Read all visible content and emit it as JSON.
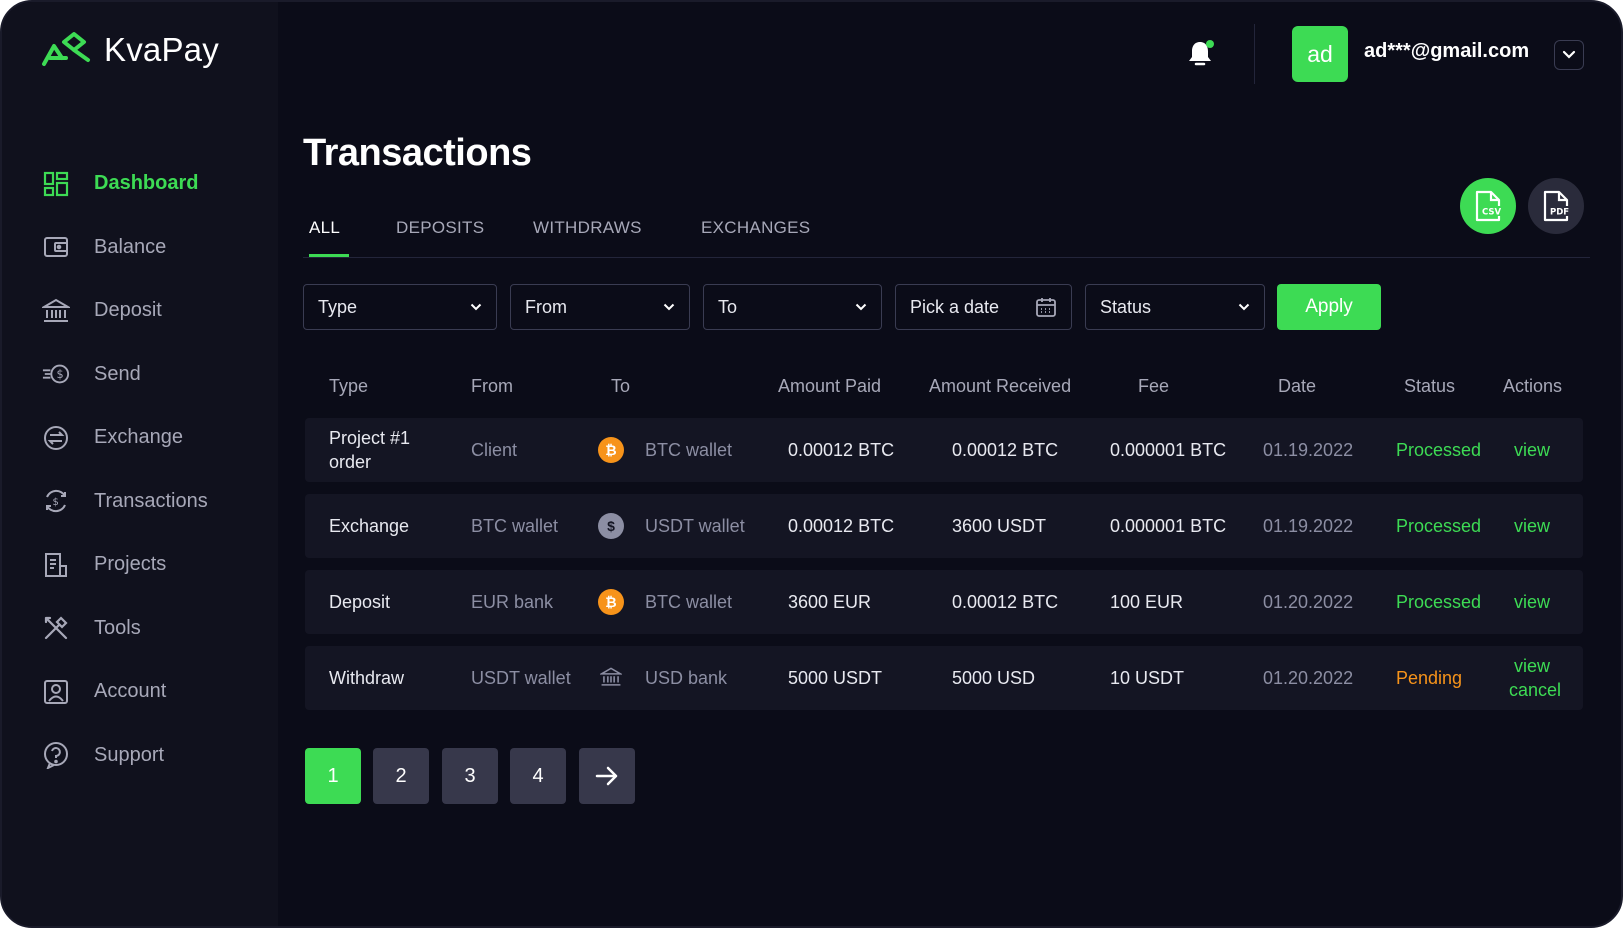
{
  "brand": {
    "name": "KvaPay"
  },
  "sidebar": {
    "items": [
      {
        "label": "Dashboard",
        "icon": "dashboard-icon",
        "active": true
      },
      {
        "label": "Balance",
        "icon": "wallet-icon"
      },
      {
        "label": "Deposit",
        "icon": "bank-icon"
      },
      {
        "label": "Send",
        "icon": "send-coin-icon"
      },
      {
        "label": "Exchange",
        "icon": "exchange-icon"
      },
      {
        "label": "Transactions",
        "icon": "transactions-icon"
      },
      {
        "label": "Projects",
        "icon": "document-icon"
      },
      {
        "label": "Tools",
        "icon": "tools-icon"
      },
      {
        "label": "Account",
        "icon": "account-icon"
      },
      {
        "label": "Support",
        "icon": "help-icon"
      }
    ]
  },
  "header": {
    "avatar_initials": "ad",
    "user_email": "ad***@gmail.com"
  },
  "main": {
    "title": "Transactions",
    "export": {
      "csv_label": "CSV",
      "pdf_label": "PDF"
    },
    "tabs": [
      {
        "label": "ALL",
        "active": true
      },
      {
        "label": "DEPOSITS"
      },
      {
        "label": "WITHDRAWS"
      },
      {
        "label": "EXCHANGES"
      }
    ],
    "filters": {
      "type": "Type",
      "from": "From",
      "to": "To",
      "date": "Pick a date",
      "status": "Status",
      "apply": "Apply"
    },
    "table": {
      "columns": [
        "Type",
        "From",
        "To",
        "Amount Paid",
        "Amount Received",
        "Fee",
        "Date",
        "Status",
        "Actions"
      ],
      "rows": [
        {
          "type_line1": "Project #1",
          "type_line2": "order",
          "from": "Client",
          "to_icon": "bitcoin-icon",
          "to": "BTC wallet",
          "paid": "0.00012 BTC",
          "received": "0.00012 BTC",
          "fee": "0.000001 BTC",
          "date": "01.19.2022",
          "status": "Processed",
          "action1": "view"
        },
        {
          "type": "Exchange",
          "from": "BTC wallet",
          "to_icon": "usdt-icon",
          "to": "USDT wallet",
          "paid": "0.00012 BTC",
          "received": "3600 USDT",
          "fee": "0.000001 BTC",
          "date": "01.19.2022",
          "status": "Processed",
          "action1": "view"
        },
        {
          "type": "Deposit",
          "from": "EUR bank",
          "to_icon": "bitcoin-icon",
          "to": "BTC wallet",
          "paid": "3600 EUR",
          "received": "0.00012 BTC",
          "fee": "100 EUR",
          "date": "01.20.2022",
          "status": "Processed",
          "action1": "view"
        },
        {
          "type": "Withdraw",
          "from": "USDT wallet",
          "to_icon": "bank-icon",
          "to": "USD bank",
          "paid": "5000 USDT",
          "received": "5000 USD",
          "fee": "10 USDT",
          "date": "01.20.2022",
          "status": "Pending",
          "action1": "view",
          "action2": "cancel"
        }
      ]
    },
    "pagination": {
      "pages": [
        "1",
        "2",
        "3",
        "4"
      ],
      "current": "1"
    }
  },
  "colors": {
    "accent": "#3ddb54",
    "background": "#0b0c18",
    "sidebar": "#10111d",
    "row": "#141523",
    "pending": "#f7931a",
    "bitcoin": "#f7931a"
  }
}
